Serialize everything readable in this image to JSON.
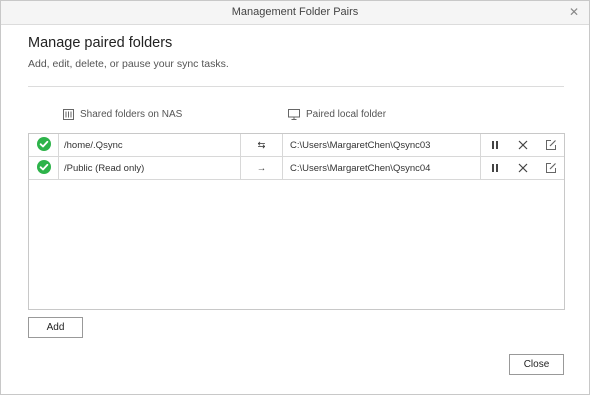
{
  "window": {
    "title": "Management Folder Pairs",
    "close_icon": "close-icon"
  },
  "header": {
    "title": "Manage paired folders",
    "subtitle": "Add, edit, delete, or pause your sync tasks."
  },
  "columns": {
    "nas_label": "Shared folders on NAS",
    "nas_icon": "nas-icon",
    "local_label": "Paired local folder",
    "local_icon": "monitor-icon"
  },
  "pairs": [
    {
      "status_icon": "check-circle-icon",
      "nas_folder": "/home/.Qsync",
      "direction_icon": "two-way-sync-icon",
      "direction_glyph": "⇆",
      "local_folder": "C:\\Users\\MargaretChen\\Qsync03"
    },
    {
      "status_icon": "check-circle-icon",
      "nas_folder": "/Public (Read only)",
      "direction_icon": "one-way-arrow-icon",
      "direction_glyph": "→",
      "local_folder": "C:\\Users\\MargaretChen\\Qsync04"
    }
  ],
  "buttons": {
    "add": "Add",
    "close": "Close"
  },
  "colors": {
    "status_ok": "#2db34a",
    "border": "#c8c8c8",
    "title_bg": "#f5f5f5"
  }
}
